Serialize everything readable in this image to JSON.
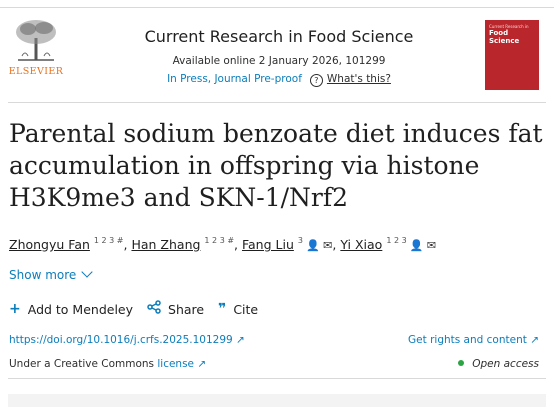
{
  "header": {
    "publisher_logo_text": "ELSEVIER",
    "journal_title": "Current Research in Food Science",
    "available_online": "Available online 2 January 2026, 101299",
    "status": "In Press, Journal Pre-proof",
    "help_icon": "question-circle-icon",
    "whats_this": "What's this?",
    "cover": {
      "small": "Current Research in",
      "title_line1": "Food Science",
      "subtitle": "",
      "color": "#b9262b"
    }
  },
  "article": {
    "title": "Parental sodium benzoate diet induces fat accumulation in offspring via histone H3K9me3 and SKN-1/Nrf2",
    "authors": [
      {
        "name": "Zhongyu Fan",
        "sup": "1 2 3 #",
        "icons": ""
      },
      {
        "name": "Han Zhang",
        "sup": "1 2 3 #",
        "icons": ""
      },
      {
        "name": "Fang Liu",
        "sup": "3",
        "icons": "👤 ✉"
      },
      {
        "name": "Yi Xiao",
        "sup": "1 2 3",
        "icons": "👤 ✉"
      }
    ],
    "show_more": "Show more"
  },
  "actions": {
    "add_mendeley": "Add to Mendeley",
    "share": "Share",
    "cite": "Cite"
  },
  "links": {
    "doi": "https://doi.org/10.1016/j.crfs.2025.101299 ↗",
    "rights": "Get rights and content ↗",
    "license_prefix": "Under a Creative Commons ",
    "license_link": "license ↗",
    "open_access": "Open access"
  },
  "colors": {
    "link": "#0c7dbb",
    "elsevier_orange": "#e9711c",
    "open_access_dot": "#2ca444"
  }
}
